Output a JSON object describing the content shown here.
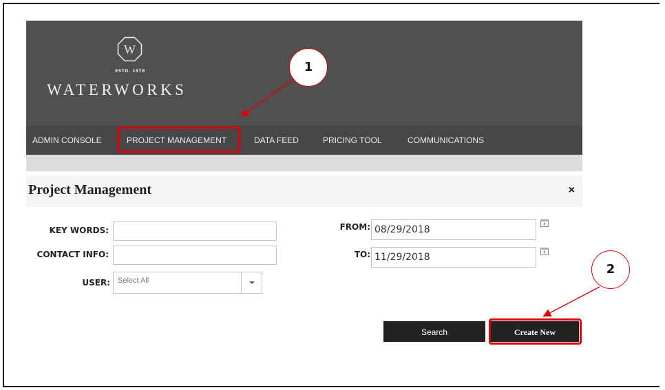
{
  "brand": {
    "logo_letter": "W",
    "estd": "ESTD. 1978",
    "name": "WATERWORKS"
  },
  "nav": {
    "items": [
      {
        "label": "ADMIN CONSOLE"
      },
      {
        "label": "PROJECT MANAGEMENT"
      },
      {
        "label": "DATA FEED"
      },
      {
        "label": "PRICING TOOL"
      },
      {
        "label": "COMMUNICATIONS"
      }
    ]
  },
  "panel": {
    "title": "Project Management",
    "close_glyph": "×"
  },
  "form": {
    "keywords_label": "KEY WORDS:",
    "keywords_value": "",
    "contact_label": "CONTACT INFO:",
    "contact_value": "",
    "user_label": "USER:",
    "user_selected": "Select All",
    "from_label": "FROM:",
    "from_value": "08/29/2018",
    "to_label": "TO:",
    "to_value": "11/29/2018"
  },
  "buttons": {
    "search_label": "Search",
    "create_label": "Create New"
  },
  "annotations": {
    "step1": "1",
    "step2": "2",
    "highlight_color": "#e0000a"
  },
  "colors": {
    "header_bg": "#505050",
    "nav_bg": "#474747",
    "button_bg": "#222222"
  }
}
